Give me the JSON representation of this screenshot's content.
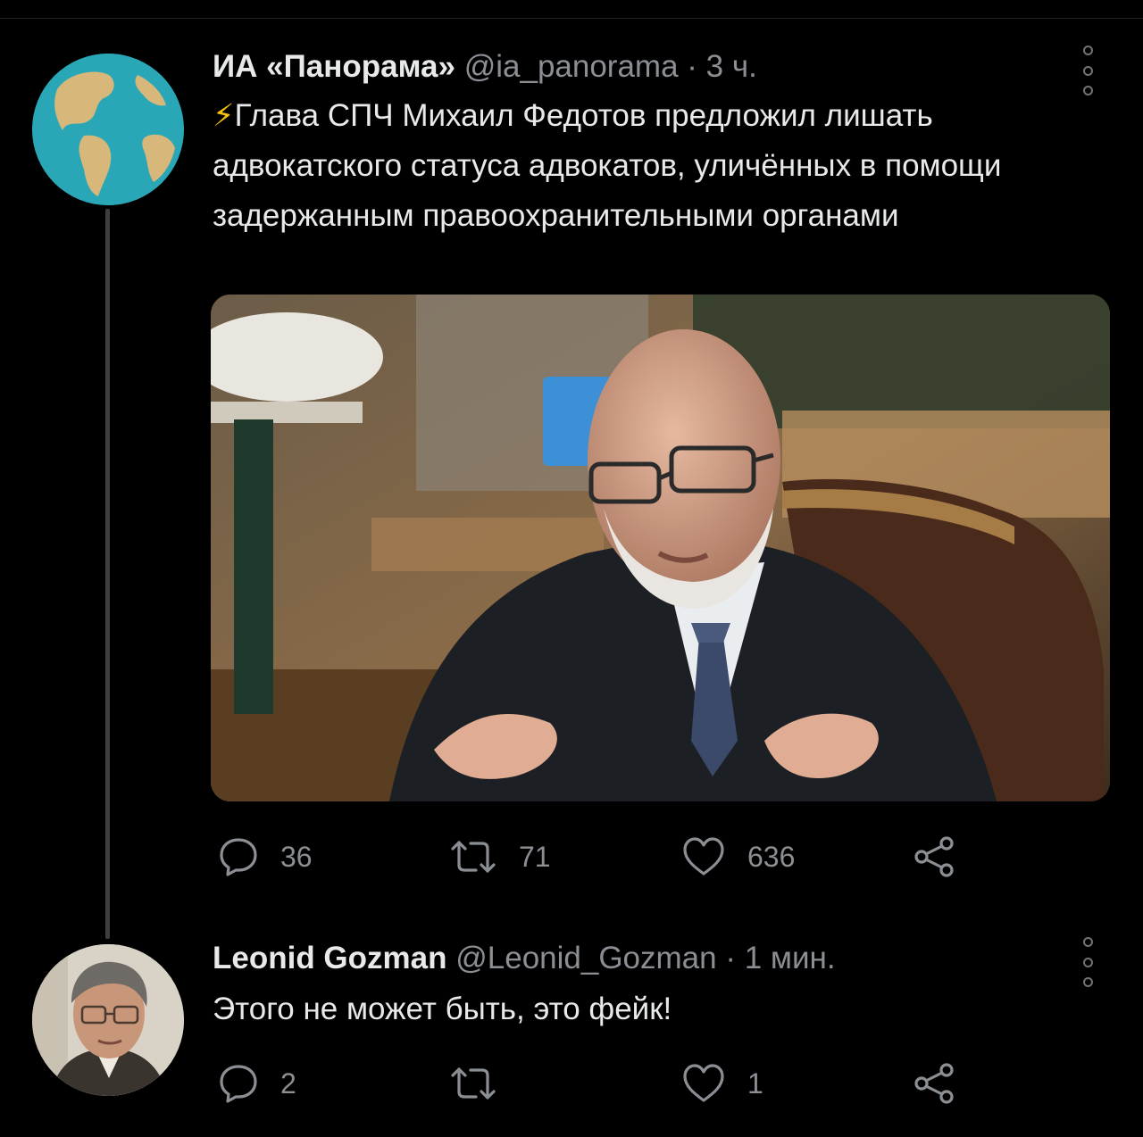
{
  "tweets": [
    {
      "author": {
        "display_name": "ИА «Панорама»",
        "handle": "@ia_panorama",
        "separator": "·",
        "time": "3 ч."
      },
      "text_prefix_icon": "⚡",
      "text": "Глава СПЧ Михаил Федотов предложил лишать адвокатского статуса адвокатов, уличённых в помощи задержанным правоохранительными органами",
      "has_media": true,
      "stats": {
        "replies": "36",
        "retweets": "71",
        "likes": "636"
      }
    },
    {
      "author": {
        "display_name": "Leonid Gozman",
        "handle": "@Leonid_Gozman",
        "separator": "·",
        "time": "1 мин."
      },
      "text": "Этого не может быть, это фейк!",
      "has_media": false,
      "stats": {
        "replies": "2",
        "retweets": "",
        "likes": "1"
      }
    }
  ],
  "icons": {
    "reply": "reply-icon",
    "retweet": "retweet-icon",
    "like": "heart-icon",
    "share": "share-icon",
    "more": "more-options-icon"
  },
  "colors": {
    "background": "#000000",
    "text": "#e7e9ea",
    "secondary_text": "#8b8f94",
    "icon": "#8b8f94",
    "bolt": "#f4c20d"
  }
}
